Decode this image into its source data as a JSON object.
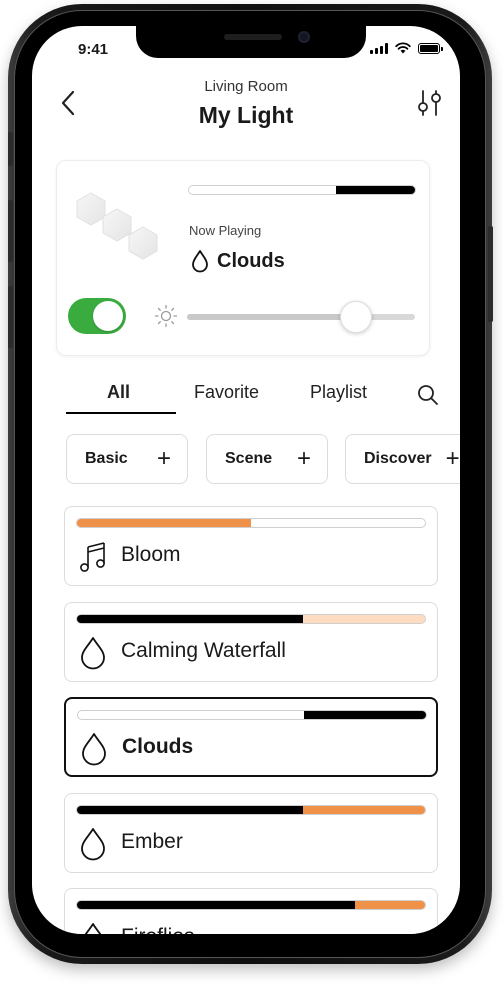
{
  "status": {
    "time": "9:41"
  },
  "header": {
    "room": "Living Room",
    "title": "My Light"
  },
  "now_playing": {
    "label": "Now Playing",
    "title": "Clouds",
    "progress_segments": [
      {
        "start": 0.65,
        "end": 1.0,
        "color": "#000000"
      }
    ],
    "power_on": true,
    "brightness": 0.74
  },
  "tabs": [
    {
      "label": "All",
      "active": true
    },
    {
      "label": "Favorite",
      "active": false
    },
    {
      "label": "Playlist",
      "active": false
    }
  ],
  "chips": [
    {
      "label": "Basic"
    },
    {
      "label": "Scene"
    },
    {
      "label": "Discover"
    }
  ],
  "colors": {
    "accent": "#f0914a",
    "accent_light": "#fddcc2",
    "toggle": "#3aac3f"
  },
  "items": [
    {
      "name": "Bloom",
      "icon": "music-note-icon",
      "selected": false,
      "segments": [
        {
          "start": 0,
          "end": 0.5,
          "color": "#f0914a"
        }
      ]
    },
    {
      "name": "Calming Waterfall",
      "icon": "drop-icon",
      "selected": false,
      "segments": [
        {
          "start": 0,
          "end": 0.65,
          "color": "#000000"
        },
        {
          "start": 0.65,
          "end": 1.0,
          "color": "#fddcc2"
        }
      ]
    },
    {
      "name": "Clouds",
      "icon": "drop-icon",
      "selected": true,
      "segments": [
        {
          "start": 0.65,
          "end": 1.0,
          "color": "#000000"
        }
      ]
    },
    {
      "name": "Ember",
      "icon": "drop-icon",
      "selected": false,
      "segments": [
        {
          "start": 0,
          "end": 0.65,
          "color": "#000000"
        },
        {
          "start": 0.65,
          "end": 1.0,
          "color": "#f0914a"
        }
      ]
    },
    {
      "name": "Fireflies",
      "icon": "drop-icon",
      "selected": false,
      "segments": [
        {
          "start": 0,
          "end": 0.8,
          "color": "#000000"
        },
        {
          "start": 0.8,
          "end": 1.0,
          "color": "#f0914a"
        }
      ]
    }
  ]
}
